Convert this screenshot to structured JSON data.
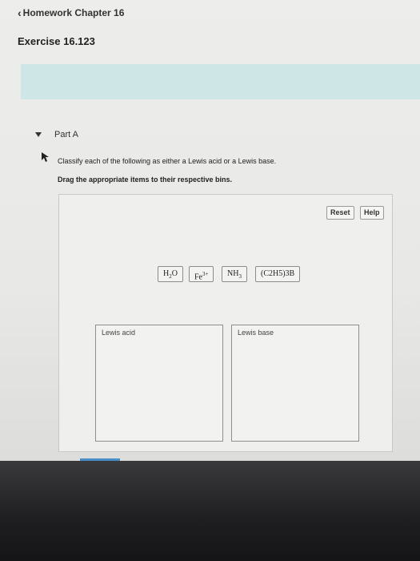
{
  "header": {
    "back_chevron": "‹",
    "back_label": "Homework Chapter 16",
    "exercise_title": "Exercise 16.123"
  },
  "part": {
    "label": "Part A",
    "instruction": "Classify each of the following as either a Lewis acid or a Lewis base.",
    "drag_instruction": "Drag the appropriate items to their respective bins."
  },
  "toolbar": {
    "reset_label": "Reset",
    "help_label": "Help"
  },
  "items": [
    {
      "id": "h2o",
      "main": "H",
      "sub": "2",
      "tail": "O"
    },
    {
      "id": "fe3",
      "main": "Fe",
      "sup": "3+"
    },
    {
      "id": "nh3",
      "main": "NH",
      "sub": "3"
    },
    {
      "id": "c2h5_3b",
      "text": "(C2H5)3B"
    }
  ],
  "bins": {
    "acid_label": "Lewis acid",
    "base_label": "Lewis base"
  },
  "colors": {
    "banner": "#cfe6e6",
    "accent": "#4a90c8"
  }
}
